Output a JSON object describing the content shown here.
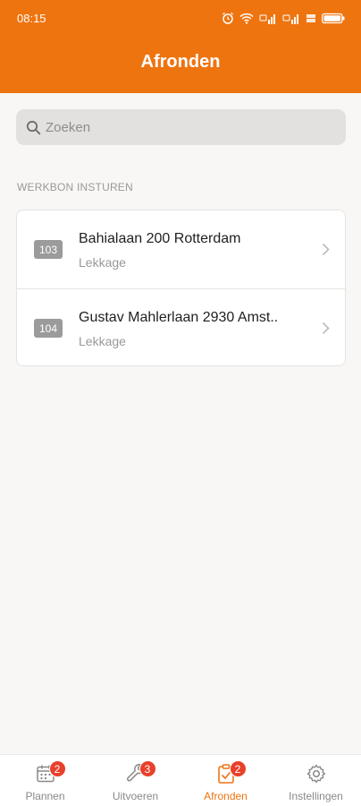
{
  "status_bar": {
    "time": "08:15",
    "battery": "100"
  },
  "header": {
    "title": "Afronden"
  },
  "search": {
    "placeholder": "Zoeken"
  },
  "section": {
    "label": "WERKBON INSTUREN"
  },
  "work_orders": [
    {
      "number": "103",
      "address": "Bahialaan 200 Rotterdam",
      "type": "Lekkage"
    },
    {
      "number": "104",
      "address": "Gustav Mahlerlaan 2930 Amst..",
      "type": "Lekkage"
    }
  ],
  "tabs": [
    {
      "label": "Plannen",
      "badge": "2",
      "icon": "calendar-icon"
    },
    {
      "label": "Uitvoeren",
      "badge": "3",
      "icon": "wrench-icon"
    },
    {
      "label": "Afronden",
      "badge": "2",
      "icon": "clipboard-check-icon"
    },
    {
      "label": "Instellingen",
      "icon": "gear-icon"
    }
  ],
  "colors": {
    "accent": "#ee7410",
    "badge_red": "#e8402a"
  }
}
